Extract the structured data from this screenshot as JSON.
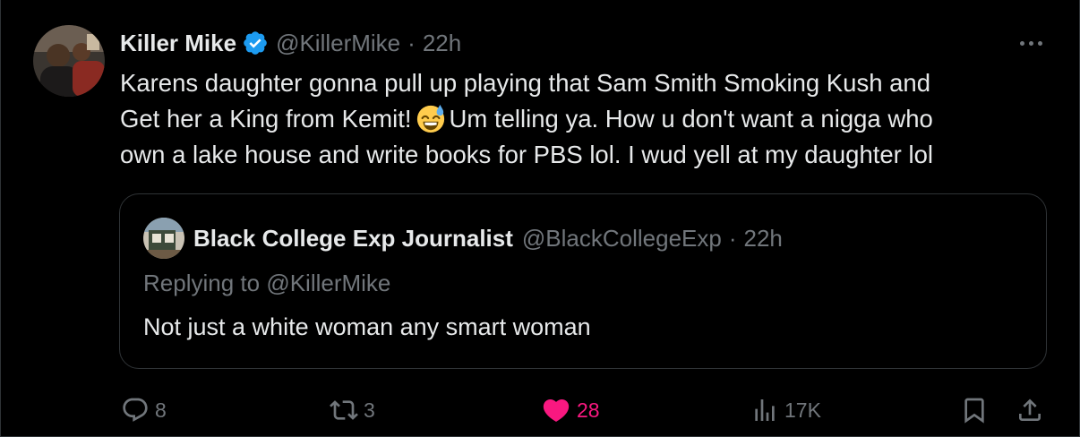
{
  "tweet": {
    "author_name": "Killer Mike",
    "author_handle": "@KillerMike",
    "separator": "·",
    "time": "22h",
    "text_lines": [
      "Karens daughter gonna pull up playing that Sam Smith Smoking Kush and",
      "Get her a King from Kemit!",
      "Um telling ya.  How u don't want a nigga who",
      "own a lake house and write books for PBS lol. I wud yell at my daughter lol"
    ]
  },
  "quote": {
    "author_name": "Black College Exp Journalist",
    "author_handle": "@BlackCollegeExp",
    "separator": "·",
    "time": "22h",
    "reply_prefix": "Replying to",
    "reply_mention": "@KillerMike",
    "text": "Not just a white woman any smart woman"
  },
  "actions": {
    "replies": "8",
    "reposts": "3",
    "likes": "28",
    "views": "17K"
  },
  "colors": {
    "background": "#000000",
    "text": "#e7e9ea",
    "muted": "#71767b",
    "border": "#2f3336",
    "verified": "#1d9bf0",
    "like": "#f91880"
  },
  "icons": [
    "verified-badge-icon",
    "more-icon",
    "reply-icon",
    "repost-icon",
    "heart-icon",
    "views-icon",
    "bookmark-icon",
    "share-icon",
    "sweat-smile-emoji"
  ]
}
